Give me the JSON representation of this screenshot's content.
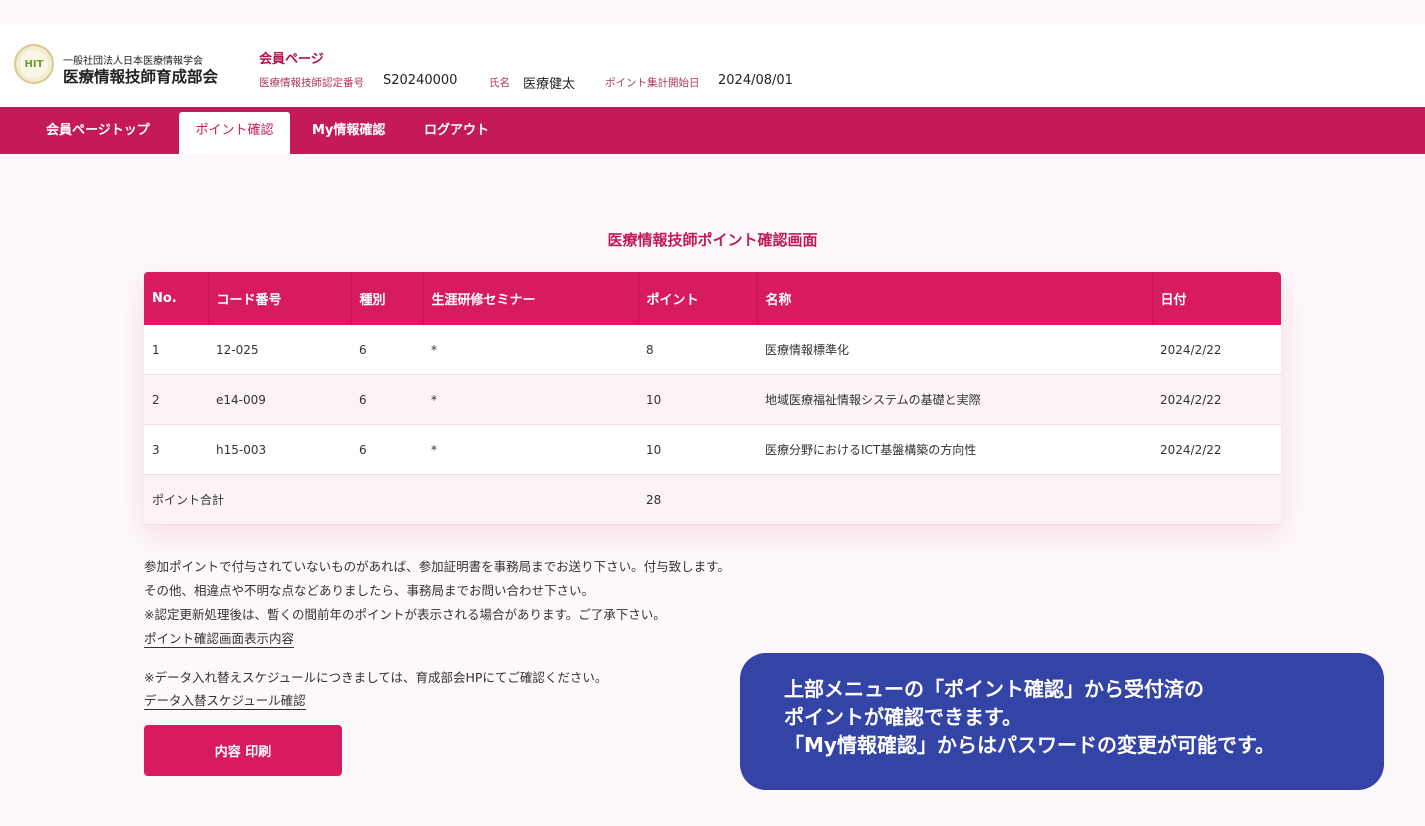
{
  "header": {
    "logo_text": "HIT",
    "org_sub": "一般社団法人日本医療情報学会",
    "org_main": "医療情報技師育成部会",
    "member_page_title": "会員ページ",
    "cert_label": "医療情報技師認定番号",
    "cert_value": "S20240000",
    "name_label": "氏名",
    "name_value": "医療健太",
    "start_label": "ポイント集計開始日",
    "start_value": "2024/08/01"
  },
  "nav": {
    "items": [
      {
        "label": "会員ページトップ"
      },
      {
        "label": "ポイント確認"
      },
      {
        "label": "My情報確認"
      },
      {
        "label": "ログアウト"
      }
    ],
    "active": "ポイント確認"
  },
  "main": {
    "heading": "医療情報技師ポイント確認画面",
    "table": {
      "headers": [
        "No.",
        "コード番号",
        "種別",
        "生涯研修セミナー",
        "ポイント",
        "名称",
        "日付"
      ],
      "rows": [
        [
          "1",
          "12-025",
          "6",
          "*",
          "8",
          "医療情報標準化",
          "2024/2/22"
        ],
        [
          "2",
          "e14-009",
          "6",
          "*",
          "10",
          "地域医療福祉情報システムの基礎と実際",
          "2024/2/22"
        ],
        [
          "3",
          "h15-003",
          "6",
          "*",
          "10",
          "医療分野におけるICT基盤構築の方向性",
          "2024/2/22"
        ]
      ],
      "total_label": "ポイント合計",
      "total_value": "28"
    },
    "notes": [
      "参加ポイントで付与されていないものがあれば、参加証明書を事務局までお送り下さい。付与致します。",
      "その他、相違点や不明な点などありましたら、事務局までお問い合わせ下さい。",
      "※認定更新処理後は、暫くの間前年のポイントが表示される場合があります。ご了承下さい。"
    ],
    "link1": "ポイント確認画面表示内容",
    "schedule_note": "※データ入れ替えスケジュールにつきましては、育成部会HPにてご確認ください。",
    "link2": "データ入替スケジュール確認",
    "print_button": "内容 印刷"
  },
  "callout": {
    "lines": [
      "上部メニューの「ポイント確認」から受付済の",
      "ポイントが確認できます。",
      "「My情報確認」からはパスワードの変更が可能です。"
    ]
  },
  "colors": {
    "brand": "#c41a5a",
    "table_header": "#d81b60",
    "callout_bg": "#3443a6"
  }
}
